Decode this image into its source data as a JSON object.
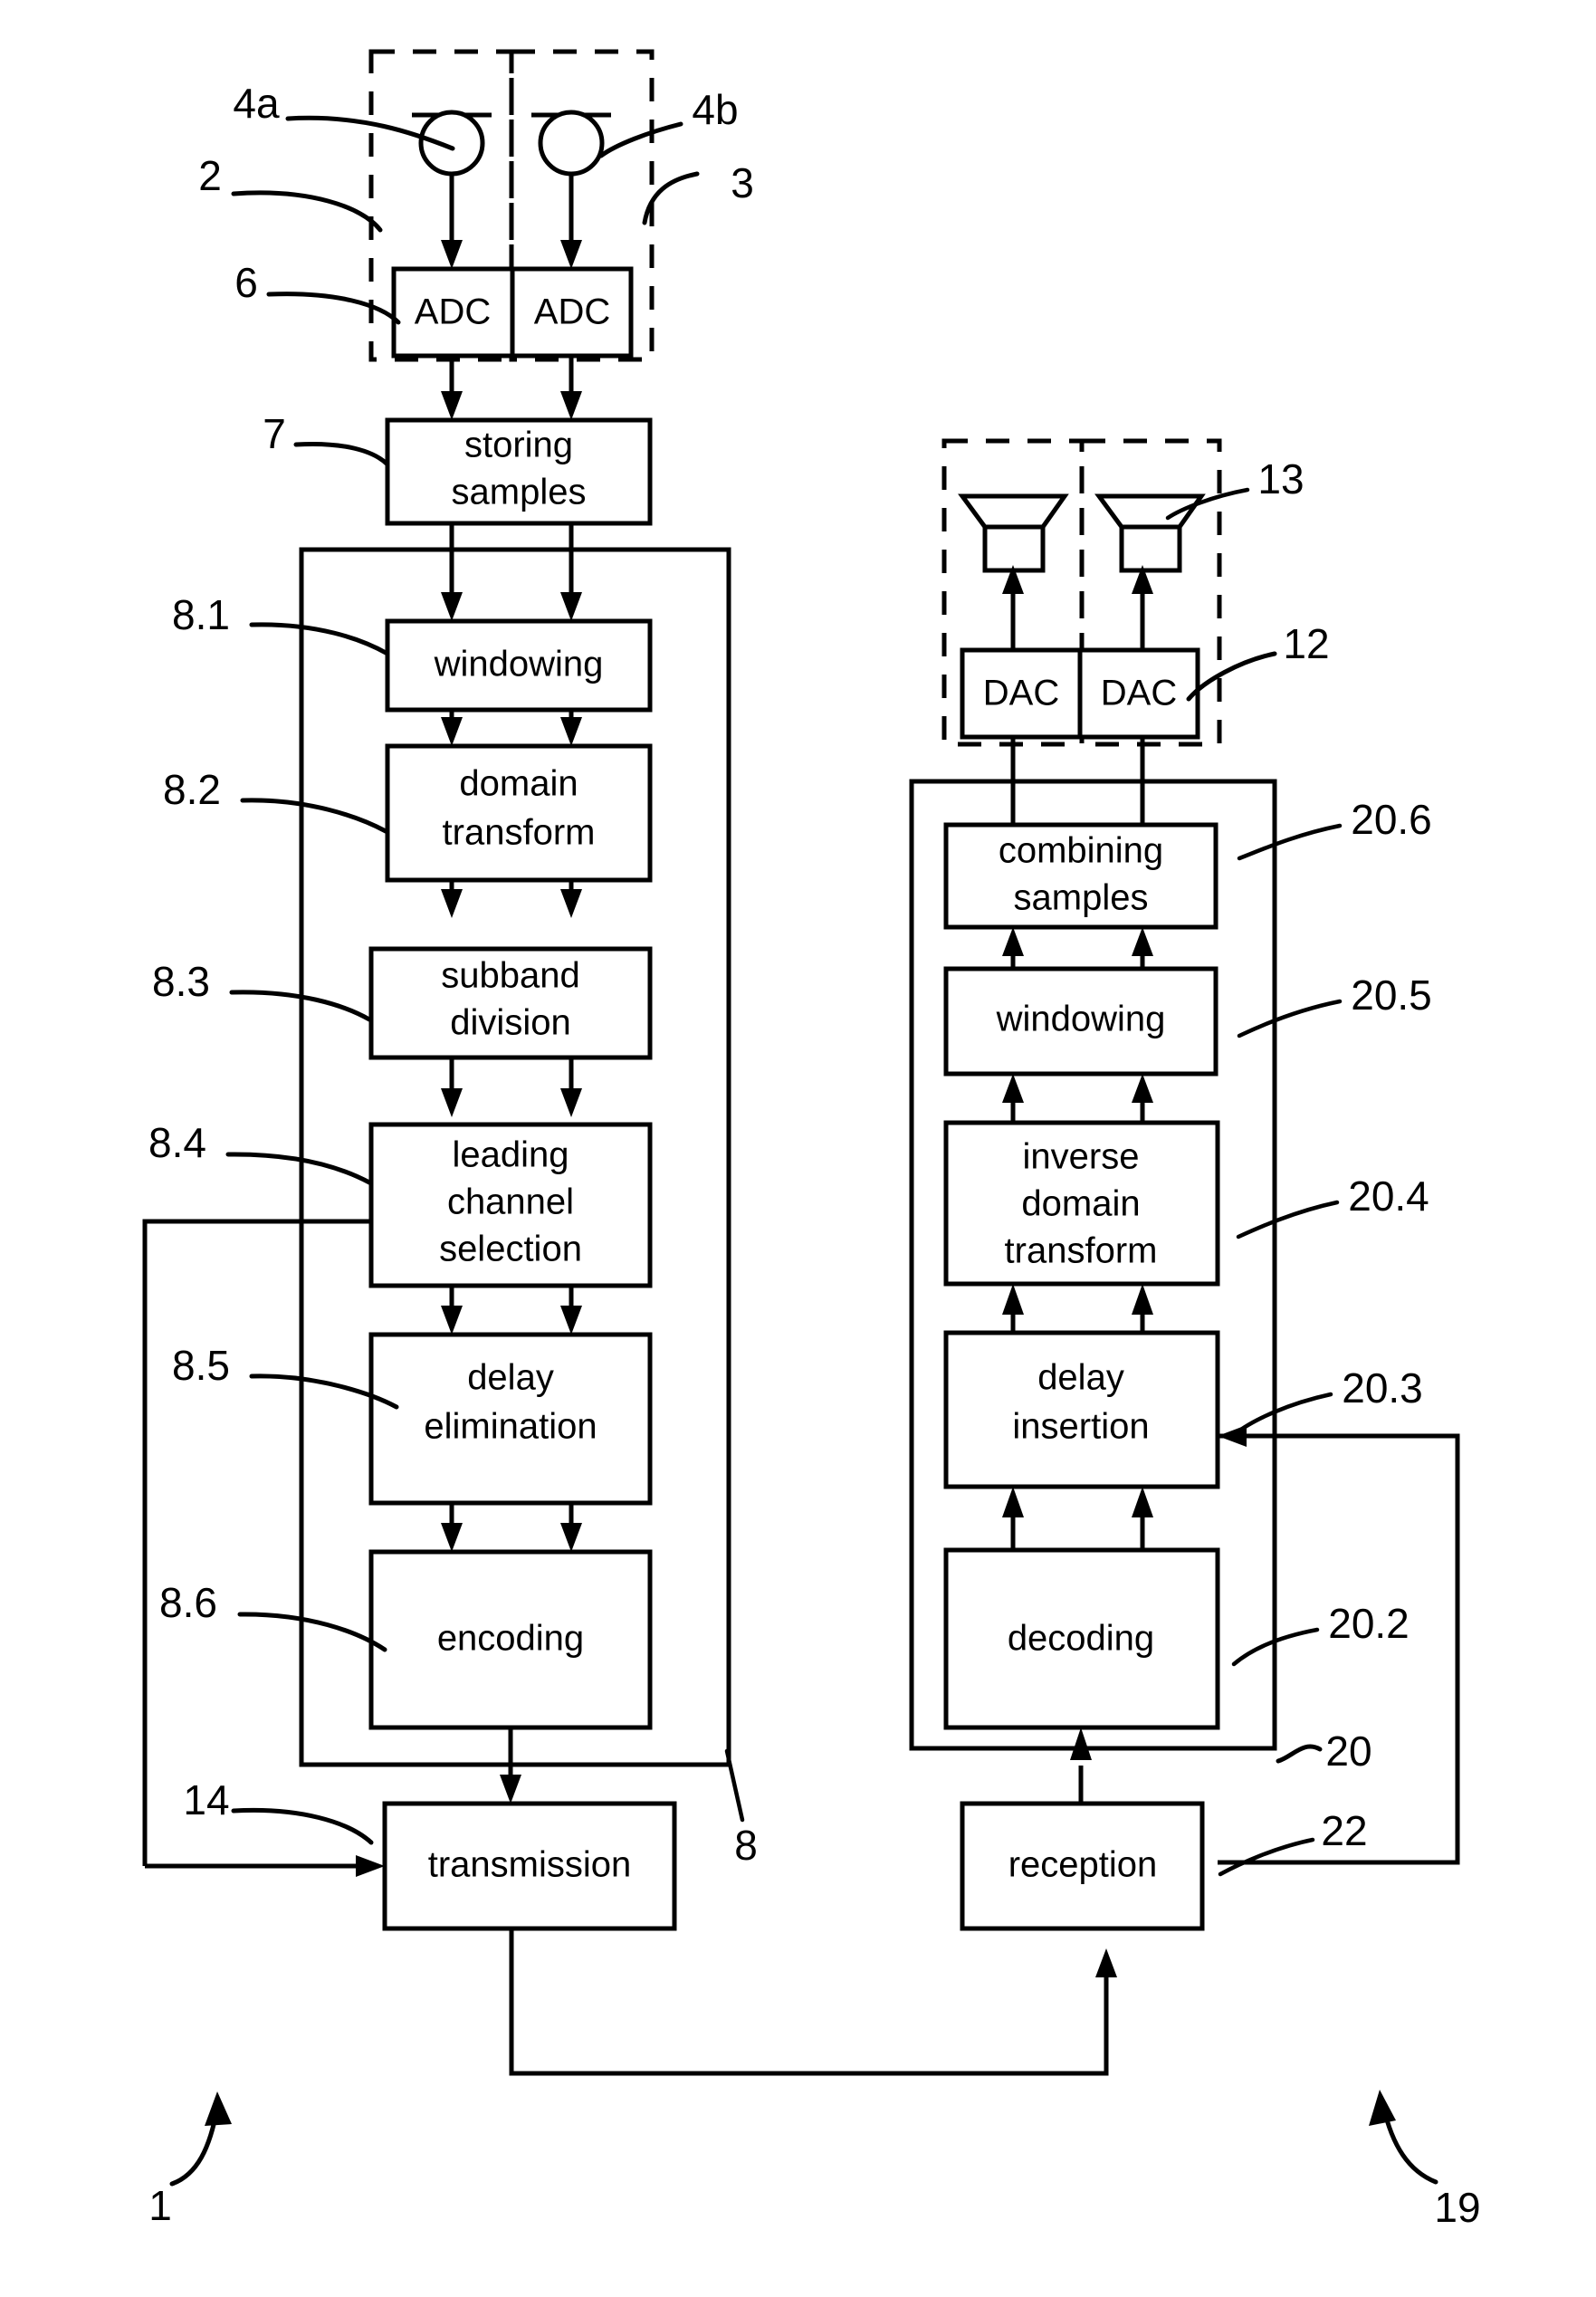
{
  "figure": {
    "title": "Audio transmission system block diagram",
    "ink_color": "#000000",
    "background_color": "#ffffff"
  },
  "blocks": {
    "adc_left": {
      "label": "ADC"
    },
    "adc_right": {
      "label": "ADC"
    },
    "storing_samples": {
      "line1": "storing",
      "line2": "samples"
    },
    "windowing_tx": {
      "line1": "windowing"
    },
    "domain_transform": {
      "line1": "domain",
      "line2": "transform"
    },
    "subband_division": {
      "line1": "subband",
      "line2": "division"
    },
    "leading_channel_selection": {
      "line1": "leading",
      "line2": "channel",
      "line3": "selection"
    },
    "delay_elimination": {
      "line1": "delay",
      "line2": "elimination"
    },
    "encoding": {
      "line1": "encoding"
    },
    "transmission": {
      "line1": "transmission"
    },
    "reception": {
      "line1": "reception"
    },
    "decoding": {
      "line1": "decoding"
    },
    "delay_insertion": {
      "line1": "delay",
      "line2": "insertion"
    },
    "inverse_domain_transform": {
      "line1": "inverse",
      "line2": "domain",
      "line3": "transform"
    },
    "windowing_rx": {
      "line1": "windowing"
    },
    "combining_samples": {
      "line1": "combining",
      "line2": "samples"
    },
    "dac_left": {
      "label": "DAC"
    },
    "dac_right": {
      "label": "DAC"
    }
  },
  "reference_numerals": {
    "n1": "1",
    "n2": "2",
    "n3": "3",
    "n4a": "4a",
    "n4b": "4b",
    "n6": "6",
    "n7": "7",
    "n8": "8",
    "n8_1": "8.1",
    "n8_2": "8.2",
    "n8_3": "8.3",
    "n8_4": "8.4",
    "n8_5": "8.5",
    "n8_6": "8.6",
    "n12": "12",
    "n13": "13",
    "n14": "14",
    "n19": "19",
    "n20": "20",
    "n20_2": "20.2",
    "n20_3": "20.3",
    "n20_4": "20.4",
    "n20_5": "20.5",
    "n20_6": "20.6",
    "n22": "22"
  },
  "icons": {
    "microphone_left": "microphone-icon",
    "microphone_right": "microphone-icon",
    "loudspeaker_left": "loudspeaker-icon",
    "loudspeaker_right": "loudspeaker-icon"
  }
}
